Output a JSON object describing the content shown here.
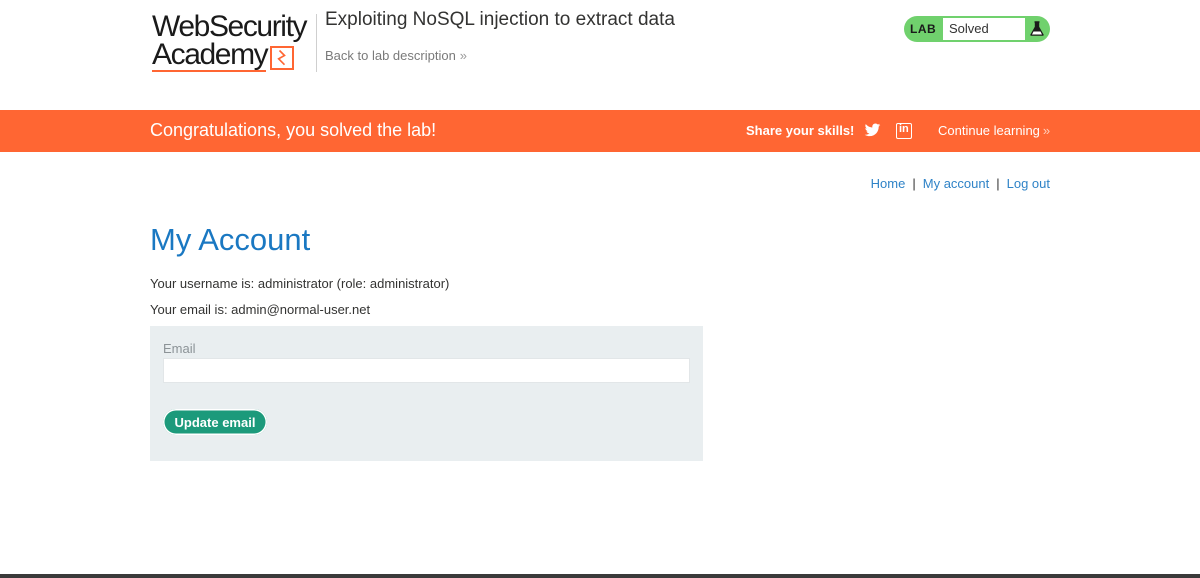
{
  "header": {
    "logo_line1": "WebSecurity",
    "logo_line2": "Academy",
    "lab_title": "Exploiting NoSQL injection to extract data",
    "back_link": "Back to lab description",
    "back_chevron": "»"
  },
  "lab_badge": {
    "label": "LAB",
    "status": "Solved",
    "color": "#70d16d"
  },
  "banner": {
    "message": "Congratulations, you solved the lab!",
    "share_label": "Share your skills!",
    "continue_label": "Continue learning",
    "continue_chevron": "»",
    "color": "#ff6633"
  },
  "nav": {
    "home": "Home",
    "sep1": "|",
    "my_account": "My account",
    "sep2": "|",
    "log_out": "Log out"
  },
  "main": {
    "title": "My Account",
    "username_text": "Your username is: administrator (role: administrator)",
    "email_text": "Your email is: admin@normal-user.net",
    "form": {
      "email_label": "Email",
      "email_value": "",
      "update_button": "Update email"
    }
  },
  "colors": {
    "title_blue": "#1a78c2",
    "link_blue": "#2f83c7",
    "button_green": "#1c9a7b",
    "panel_bg": "#e9eef0"
  },
  "icons": [
    "twitter-icon",
    "linkedin-icon",
    "flask-icon",
    "logo-bolt-icon"
  ]
}
